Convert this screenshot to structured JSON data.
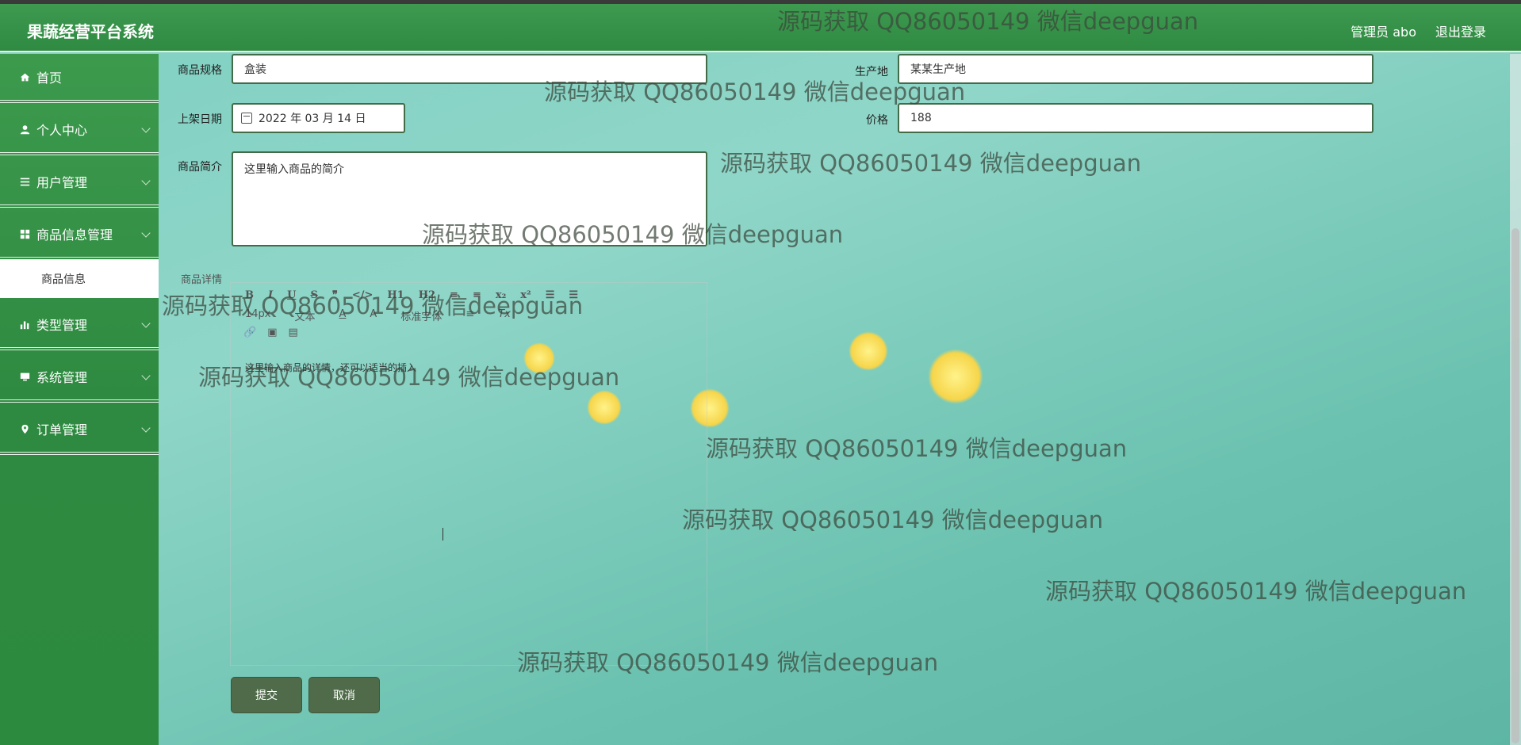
{
  "app": {
    "title": "果蔬经营平台系统",
    "user_label": "管理员 abo",
    "logout_label": "退出登录"
  },
  "sidebar": {
    "items": [
      {
        "label": "首页",
        "icon": "home-icon"
      },
      {
        "label": "个人中心",
        "icon": "user-icon"
      },
      {
        "label": "用户管理",
        "icon": "list-icon"
      },
      {
        "label": "商品信息管理",
        "icon": "grid-icon"
      },
      {
        "label": "类型管理",
        "icon": "bar-chart-icon"
      },
      {
        "label": "系统管理",
        "icon": "monitor-icon"
      },
      {
        "label": "订单管理",
        "icon": "location-icon"
      }
    ],
    "submenu": {
      "label": "商品信息"
    }
  },
  "form": {
    "spec_label": "商品规格",
    "spec_value": "盒装",
    "origin_label": "生产地",
    "origin_value": "某某生产地",
    "date_label": "上架日期",
    "date_value": "2022 年 03 月 14 日",
    "price_label": "价格",
    "price_value": "188",
    "intro_label": "商品简介",
    "intro_value": "这里输入商品的简介",
    "detail_label": "商品详情"
  },
  "editor": {
    "toolbar_row1": [
      "B",
      "I",
      "U",
      "S",
      "❞",
      "</>",
      "H1",
      "H2",
      "≡",
      "≡",
      "x₂",
      "x²",
      "☰",
      "☰"
    ],
    "font_size": "14px",
    "text_type": "文本",
    "font_family": "标准字体",
    "content": "这里输入商品的详情，还可以适当的插入"
  },
  "buttons": {
    "submit": "提交",
    "cancel": "取消"
  },
  "watermark": "源码获取 QQ86050149 微信deepguan"
}
